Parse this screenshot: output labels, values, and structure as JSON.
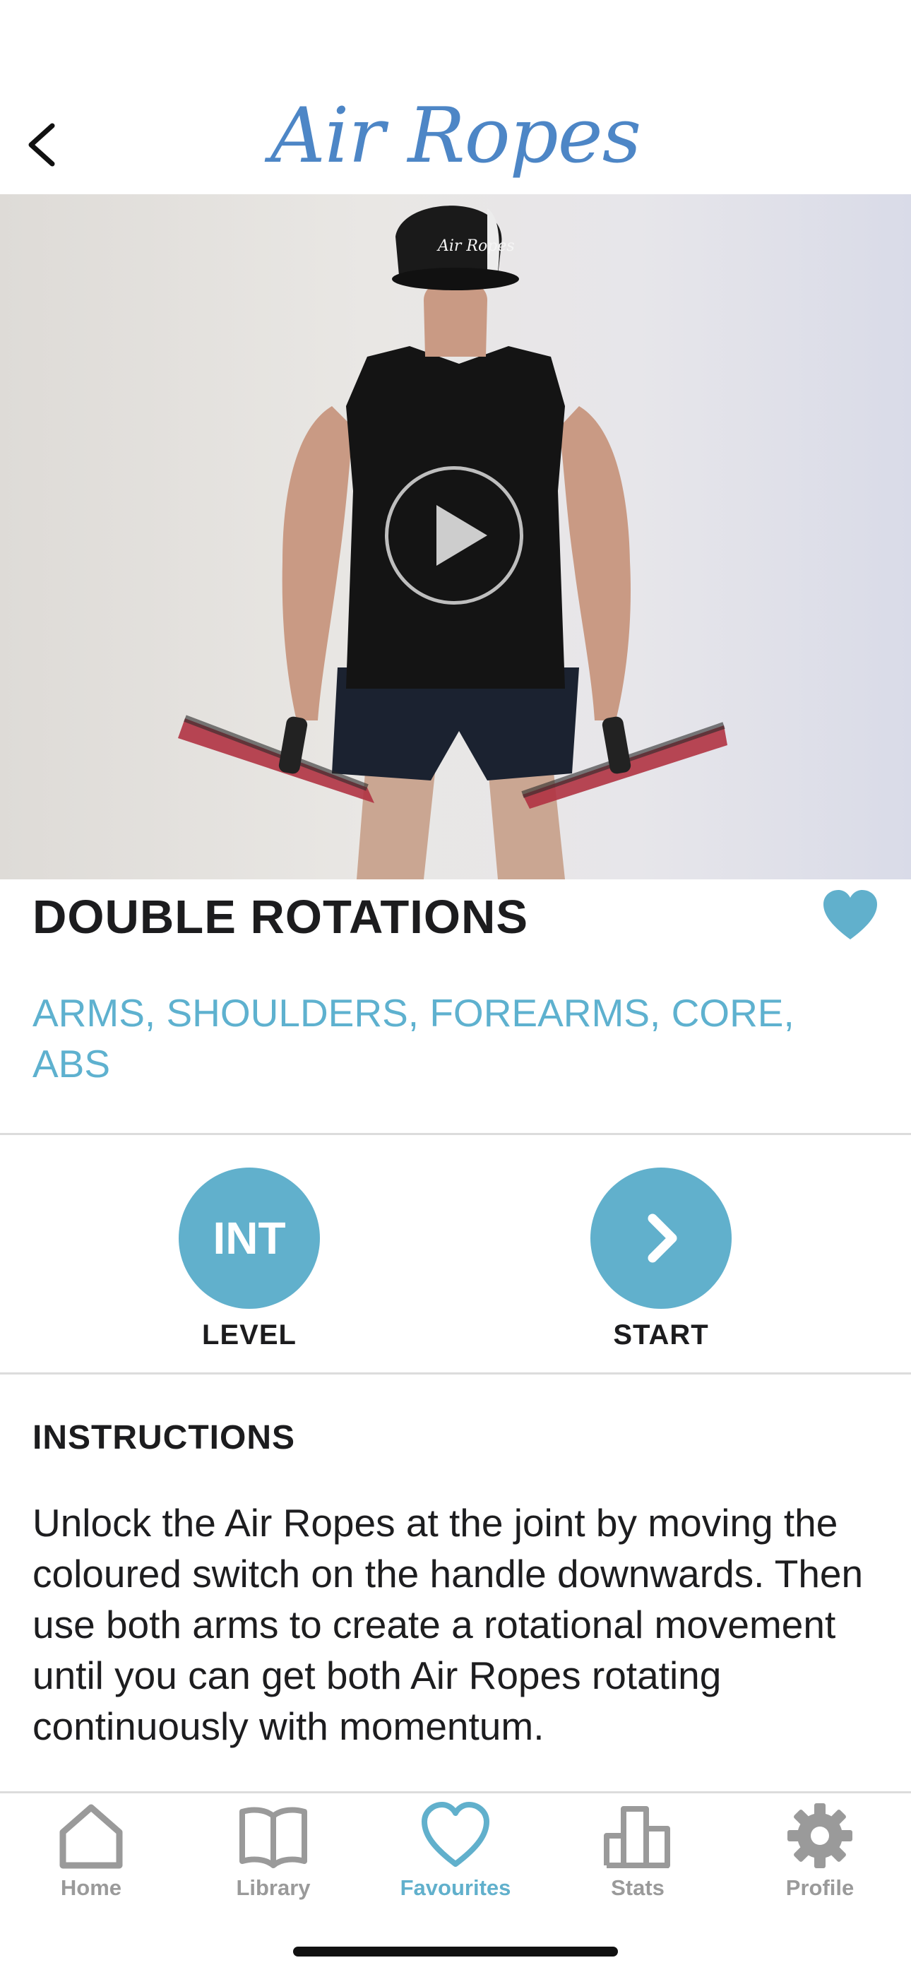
{
  "header": {
    "logo_text": "Air Ropes"
  },
  "video": {
    "cap_text": "Air Ropes"
  },
  "exercise": {
    "title": "DOUBLE ROTATIONS",
    "muscles": "ARMS, SHOULDERS, FOREARMS, CORE, ABS",
    "level_value": "INT",
    "level_label": "LEVEL",
    "start_label": "START"
  },
  "instructions": {
    "heading": "INSTRUCTIONS",
    "body": "Unlock the Air Ropes at the joint by moving the coloured switch on the handle downwards. Then use both arms to create a rotational movement until you can get both Air Ropes rotating continuously with momentum."
  },
  "tabs": [
    {
      "label": "Home",
      "icon": "house-icon",
      "active": false
    },
    {
      "label": "Library",
      "icon": "book-icon",
      "active": false
    },
    {
      "label": "Favourites",
      "icon": "heart-icon",
      "active": true
    },
    {
      "label": "Stats",
      "icon": "bar-chart-icon",
      "active": false
    },
    {
      "label": "Profile",
      "icon": "gear-icon",
      "active": false
    }
  ],
  "colors": {
    "accent": "#61b0cc",
    "logo": "#4d86c6",
    "inactive_tab": "#9a9a9a"
  }
}
